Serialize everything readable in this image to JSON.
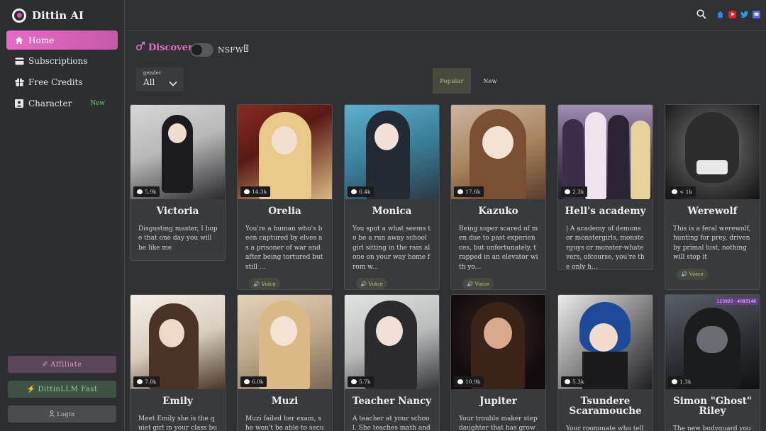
{
  "brand": {
    "name": "Dittin AI"
  },
  "nav": [
    {
      "label": "Home",
      "icon": "home-icon",
      "active": true
    },
    {
      "label": "Subscriptions",
      "icon": "card-icon"
    },
    {
      "label": "Free Credits",
      "icon": "gift-icon"
    },
    {
      "label": "Character",
      "icon": "person-icon",
      "badge": "New"
    }
  ],
  "sidebar_buttons": {
    "affiliate": "Affiliate",
    "llm": "DittinLLM Fast",
    "login": "Login"
  },
  "discover": {
    "title": "Discover",
    "nsfw_label": "NSFW"
  },
  "filter": {
    "label": "gender",
    "value": "All"
  },
  "tabs": {
    "popular": "Popular",
    "new": "New"
  },
  "colors": {
    "accent": "#e46ccd",
    "voice": "#b9c88d",
    "new_badge": "#6fd06f"
  },
  "cards": [
    {
      "name": "Victoria",
      "count": "5.9k",
      "desc": "Disgusting master, I hope that one day you will be like me",
      "voice": false,
      "palette": [
        "#c9c9c9",
        "#2a2a2e"
      ]
    },
    {
      "name": "Orelia",
      "count": "14.3k",
      "desc": "You're a human who's been captured by elves as a prisoner of war and after being tortured but still ...",
      "voice": true,
      "palette": [
        "#7a2a1e",
        "#e7c68d"
      ]
    },
    {
      "name": "Monica",
      "count": "6.4k",
      "desc": "You spot a what seems to be a run away school girl sitting in the rain alone on your way home from w...",
      "voice": true,
      "palette": [
        "#3f8fae",
        "#2e3a44"
      ]
    },
    {
      "name": "Kazuko",
      "count": "17.6k",
      "desc": "Being super scared of men due to past experiences, but unfortunately, trapped in an elevator with yo...",
      "voice": true,
      "palette": [
        "#b58c6c",
        "#6d4a36"
      ]
    },
    {
      "name": "Hell's academy",
      "count": "2.3k",
      "desc": "| A academy of demons or monstergirls, monsterguys or monster-whatevers, ofcourse, you're the only h...",
      "voice": false,
      "palette": [
        "#6a5a7c",
        "#2c2433"
      ]
    },
    {
      "name": "Werewolf",
      "count": "< 1k",
      "desc": "This is a feral werewolf, hunting for prey, driven by primal lust, nothing will stop it",
      "voice": true,
      "palette": [
        "#8e8e8e",
        "#141414"
      ]
    },
    {
      "name": "Emily",
      "count": "7.8k",
      "desc": "Meet Emily she is the quiet girl in your class but she se",
      "voice": false,
      "palette": [
        "#e9e3d9",
        "#5a3f30"
      ]
    },
    {
      "name": "Muzi",
      "count": "6.0k",
      "desc": "Muzi failed her exam, she won't be able to secure a sc",
      "voice": false,
      "palette": [
        "#d7c3a6",
        "#8e7a66"
      ]
    },
    {
      "name": "Teacher Nancy",
      "count": "5.7k",
      "desc": "A teacher at your school. She teaches math and normall",
      "voice": false,
      "palette": [
        "#cfd2d0",
        "#3b3b40"
      ]
    },
    {
      "name": "Jupiter",
      "count": "10.9k",
      "desc": "Your trouble maker step daughter that has grown up wi",
      "voice": false,
      "palette": [
        "#1b1416",
        "#7a4b3a"
      ]
    },
    {
      "name": "Tsundere Scaramouche",
      "count": "5.3k",
      "desc": "Your roommate who tells y",
      "voice": false,
      "palette": [
        "#d8d8d8",
        "#1f3a72"
      ]
    },
    {
      "name": "Simon \"Ghost\" Riley",
      "count": "1.3k",
      "desc": "The new bodyguard your fa",
      "voice": false,
      "palette": [
        "#4a4f55",
        "#151719"
      ],
      "badge": "123920 · 4083148"
    }
  ]
}
